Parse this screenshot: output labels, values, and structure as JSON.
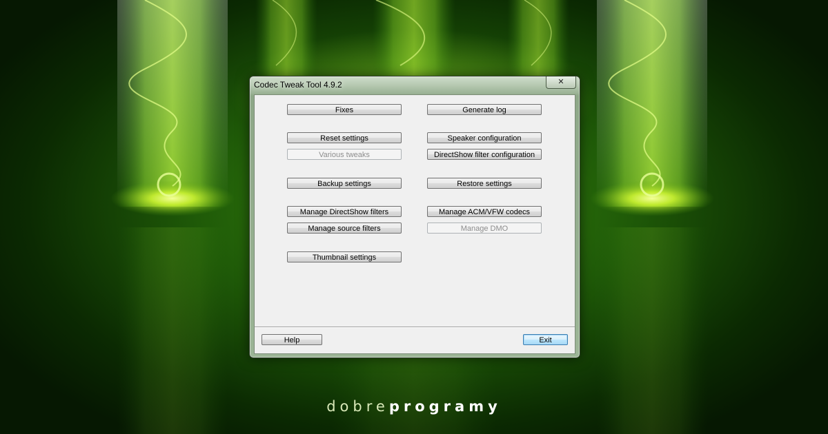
{
  "window": {
    "title": "Codec Tweak Tool 4.9.2",
    "close_glyph": "✕"
  },
  "buttons": {
    "fixes": "Fixes",
    "generate_log": "Generate log",
    "reset_settings": "Reset settings",
    "speaker_configuration": "Speaker configuration",
    "various_tweaks": "Various tweaks",
    "directshow_filter_configuration": "DirectShow filter configuration",
    "backup_settings": "Backup settings",
    "restore_settings": "Restore settings",
    "manage_directshow_filters": "Manage DirectShow filters",
    "manage_acm_vfw_codecs": "Manage ACM/VFW codecs",
    "manage_source_filters": "Manage source filters",
    "manage_dmo": "Manage DMO",
    "thumbnail_settings": "Thumbnail settings",
    "help": "Help",
    "exit": "Exit"
  },
  "disabled": [
    "various_tweaks",
    "manage_dmo"
  ],
  "watermark": {
    "light_part": "dobre",
    "bold_part": "programy"
  },
  "colors": {
    "background_green": "#2a7010",
    "accent_lime": "#b8e020"
  }
}
